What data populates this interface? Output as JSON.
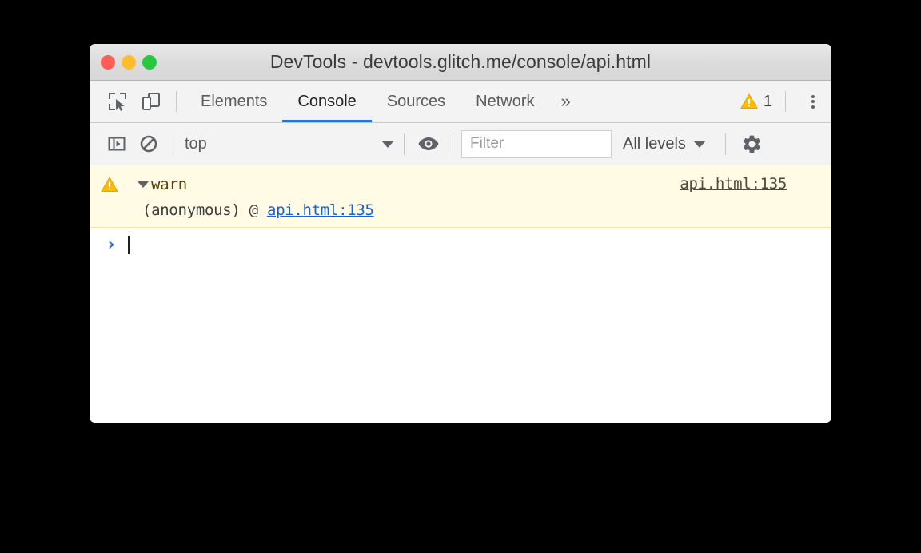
{
  "window": {
    "title": "DevTools - devtools.glitch.me/console/api.html",
    "traffic_lights": [
      {
        "name": "close",
        "color": "#ff5f57"
      },
      {
        "name": "minimize",
        "color": "#ffbd2e"
      },
      {
        "name": "maximize",
        "color": "#28c840"
      }
    ]
  },
  "tabbar": {
    "inspect_icon": "inspect-element-icon",
    "device_icon": "device-toolbar-icon",
    "tabs": [
      {
        "label": "Elements",
        "active": false
      },
      {
        "label": "Console",
        "active": true
      },
      {
        "label": "Sources",
        "active": false
      },
      {
        "label": "Network",
        "active": false
      }
    ],
    "more_label": "»",
    "warning_icon": "warning-triangle-icon",
    "warning_count": "1",
    "menu_icon": "kebab-menu-icon",
    "active_tab_accent": "#1a73e8"
  },
  "console_toolbar": {
    "sidebar_toggle_icon": "console-sidebar-toggle-icon",
    "clear_icon": "clear-console-icon",
    "context": {
      "value": "top",
      "caret_icon": "chevron-down-icon"
    },
    "eye_icon": "live-expression-eye-icon",
    "filter": {
      "value": "",
      "placeholder": "Filter"
    },
    "levels": {
      "value": "All levels",
      "caret_icon": "chevron-down-icon"
    },
    "settings_icon": "gear-icon"
  },
  "console": {
    "messages": [
      {
        "level": "warning",
        "icon": "warning-triangle-icon",
        "expander_icon": "triangle-down-icon",
        "text": "warn",
        "source_link": "api.html:135",
        "stack_prefix": "(anonymous) @ ",
        "stack_link": "api.html:135",
        "background": "#fffbe5"
      }
    ],
    "prompt": {
      "chevron": "›",
      "value": "",
      "chevron_color": "#1a73e8"
    }
  }
}
